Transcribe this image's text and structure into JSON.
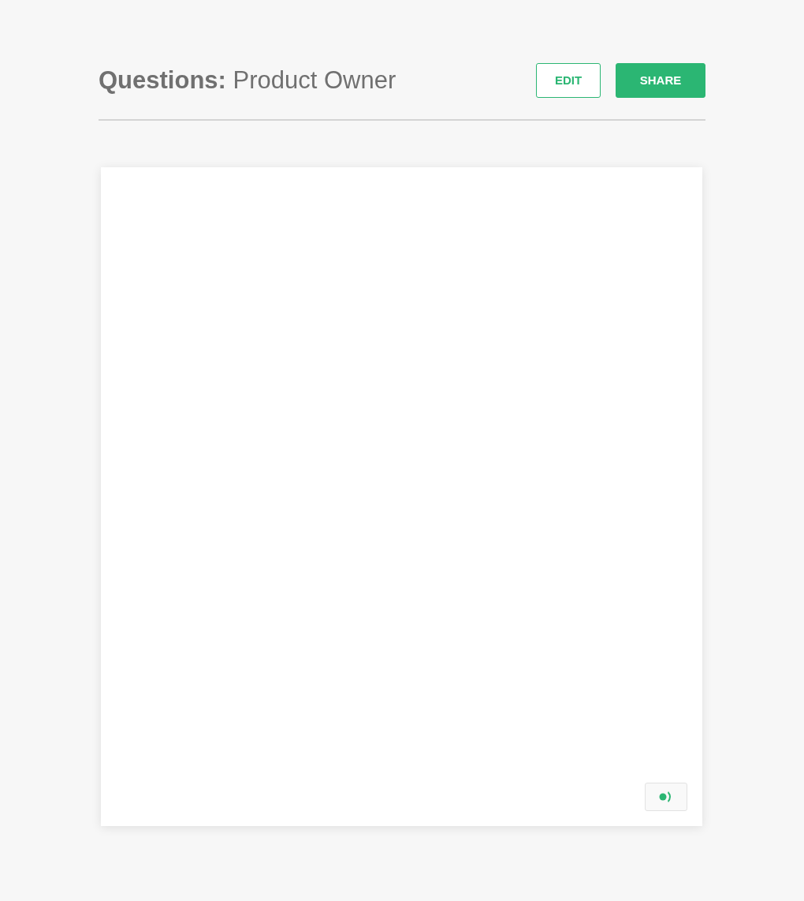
{
  "header": {
    "title": "**Questions:** Product Owner",
    "buttons": [
      {
        "label": "EDIT",
        "kind": "outline"
      },
      {
        "label": "SHARE",
        "kind": "solid"
      }
    ]
  }
}
